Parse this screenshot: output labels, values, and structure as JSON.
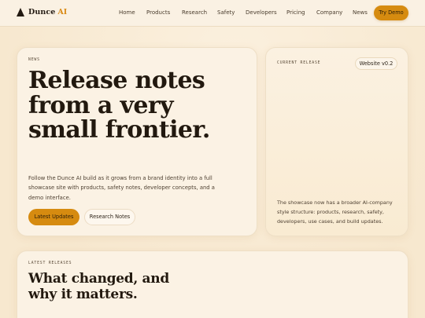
{
  "brand": {
    "name": "Dunce",
    "accent": "AI"
  },
  "nav": {
    "links": [
      "Home",
      "Products",
      "Research",
      "Safety",
      "Developers",
      "Pricing",
      "Company",
      "News"
    ],
    "cta": "Try Demo"
  },
  "hero": {
    "eyebrow": "NEWS",
    "title": "Release notes from a very small frontier.",
    "description": "Follow the Dunce AI build as it grows from a brand identity into a full showcase site with products, safety notes, developer concepts, and a demo interface.",
    "primary_button": "Latest Updates",
    "secondary_button": "Research Notes"
  },
  "release": {
    "eyebrow": "CURRENT RELEASE",
    "version": "Website v0.2",
    "description": "The showcase now has a broader AI-company style structure: products, research, safety, developers, use cases, and build updates."
  },
  "latest": {
    "eyebrow": "LATEST RELEASES",
    "title": "What changed, and why it matters."
  },
  "colors": {
    "accent": "#d68b10",
    "background": "#f8ecd6",
    "text": "#22190f"
  }
}
